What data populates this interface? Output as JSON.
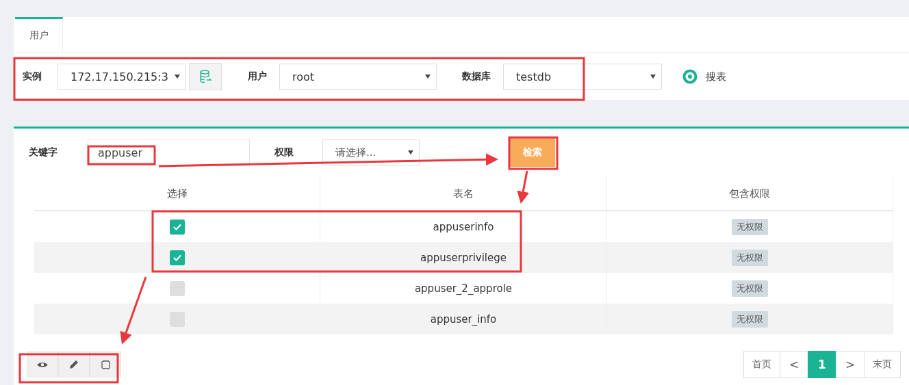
{
  "tabs": [
    {
      "label": "用户",
      "selected": true
    }
  ],
  "filters": [
    {
      "label": "实例",
      "value": "172.17.150.215:3",
      "kind": "instance"
    },
    {
      "label": "用户",
      "value": "root",
      "kind": "plain"
    },
    {
      "label": "数据库",
      "value": "testdb",
      "kind": "plain"
    }
  ],
  "search_tables": {
    "label": "搜表",
    "on": true
  },
  "keyword": {
    "label": "关键字",
    "value": "appuser"
  },
  "privilege": {
    "label": "权限",
    "placeholder": "请选择..."
  },
  "search_button": "检索",
  "table": {
    "columns": [
      "选择",
      "表名",
      "包含权限"
    ],
    "rows": [
      {
        "checked": true,
        "name": "appuserinfo",
        "privilege": "无权限"
      },
      {
        "checked": true,
        "name": "appuserprivilege",
        "privilege": "无权限"
      },
      {
        "checked": false,
        "name": "appuser_2_approle",
        "privilege": "无权限"
      },
      {
        "checked": false,
        "name": "appuser_info",
        "privilege": "无权限"
      }
    ]
  },
  "pagination": {
    "first": "首页",
    "prev": "<",
    "pages": [
      {
        "label": "1",
        "selected": true
      }
    ],
    "next": ">",
    "last": "末页"
  }
}
